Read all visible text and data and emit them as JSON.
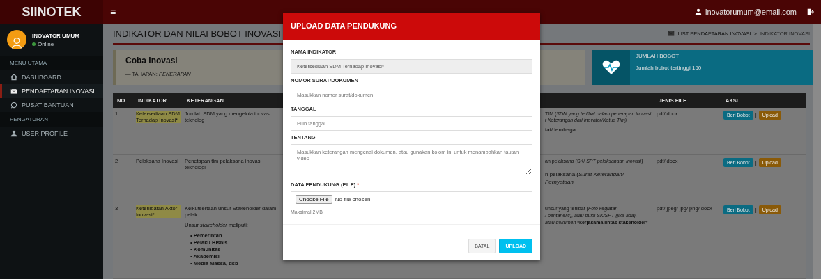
{
  "topbar": {
    "brand": "SIINOTEK",
    "menu_toggle": "≡",
    "user_email": "inovatorumum@email.com"
  },
  "sidebar": {
    "user": {
      "name": "INOVATOR UMUM",
      "status": "Online"
    },
    "sections": [
      {
        "header": "MENU UTAMA",
        "items": [
          {
            "label": "DASHBOARD",
            "selected": false
          },
          {
            "label": "PENDAFTARAN INOVASI",
            "selected": true
          },
          {
            "label": "PUSAT BANTUAN",
            "selected": false
          }
        ]
      },
      {
        "header": "PENGATURAN",
        "items": [
          {
            "label": "USER PROFILE",
            "selected": false
          }
        ]
      }
    ]
  },
  "page": {
    "title": "INDIKATOR DAN NILAI BOBOT INOVASI",
    "breadcrumb": [
      "LIST PENDAFTARAN INOVASI",
      "INDIKATOR INOVASI"
    ],
    "breadcrumb_separator": ">"
  },
  "innovation_card": {
    "name": "Coba Inovasi",
    "stage": "— TAHAPAN: *PENERAPAN*"
  },
  "info_box": {
    "label": "JUMLAH BOBOT",
    "text": "Jumlah bobot tertinggi 150"
  },
  "table": {
    "columns": [
      "NO",
      "INDIKATOR",
      "KETERANGAN",
      "JENIS FILE",
      "AKSI"
    ],
    "rows": [
      {
        "no": "1",
        "indikator": "Ketersediaan SDM Terhadap Inovasi*",
        "highlighted": true,
        "keterangan": [
          "Jumlah SDM yang mengelola inovasi teknolog"
        ],
        "list": [],
        "column_4": [
          "TIM (*SDM yang terlibat dalam penerapan inovasi*",
          "*t Keterangan dari Inovator/Ketua Tim)*",
          "tat/ lembaga"
        ],
        "jenis_file": "pdf/ docx",
        "actions": [
          "Beri Bobot",
          "|",
          "Upload"
        ]
      },
      {
        "no": "2",
        "indikator": "Pelaksana Inovasi",
        "highlighted": false,
        "keterangan": [
          "Penetapan tim pelaksana inovasi teknologi"
        ],
        "list": [],
        "column_4": [
          "an pelaksana (SK/ *SPT pelaksanaan inovasi)*",
          "n pelaksana (*Surat Keterangan/ Pernyataan*"
        ],
        "jenis_file": "pdf/ docx",
        "actions": [
          "Beri Bobot",
          "|",
          "Upload"
        ]
      },
      {
        "no": "3",
        "indikator": "Keterlibatan Aktor Inovasi*",
        "highlighted": true,
        "keterangan": [
          "Keikutsertaan unsur Stakeholder dalam pelak",
          "Unsur *stakeholder* meliputi:"
        ],
        "list": [
          "• Pemerintah",
          "• Pelaku Bisnis",
          "• Komunitas",
          "• Akademisi",
          "• Media Massa, dsb"
        ],
        "column_4": [
          "unsur yang terlibat (*Foto kegiatan*",
          "*/ pentahelic), atau bukti SK/SPT (jika ada),*",
          "*atau dokumen* ***kerjasama lintas stakeholder***"
        ],
        "jenis_file": "pdf/ jpeg/ jpg/ png/ docx",
        "actions": [
          "Beri Bobot",
          "|",
          "Upload"
        ]
      }
    ]
  },
  "modal": {
    "title": "UPLOAD DATA PENDUKUNG",
    "fields": [
      {
        "kind": "readonly",
        "label": "NAMA INDIKATOR",
        "value": "Ketersediaan SDM Terhadap Inovasi*"
      },
      {
        "kind": "text",
        "label": "NOMOR SURAT/DOKUMEN",
        "placeholder": "Masukkan nomor surat/dokumen"
      },
      {
        "kind": "text",
        "label": "TANGGAL",
        "placeholder": "Pilih tanggal"
      },
      {
        "kind": "textarea",
        "label": "TENTANG",
        "placeholder": "Masukkan keterangan mengenai dokumen, atau gunakan kolom ini untuk menambahkan tautan video"
      },
      {
        "kind": "file",
        "label": "DATA PENDUKUNG (FILE)",
        "required": "*",
        "button": "Choose File",
        "status": "No file chosen",
        "help": "Maksimal 2MB"
      }
    ],
    "buttons": [
      {
        "label": "BATAL",
        "kind": "default"
      },
      {
        "label": "UPLOAD",
        "kind": "primary"
      }
    ]
  }
}
